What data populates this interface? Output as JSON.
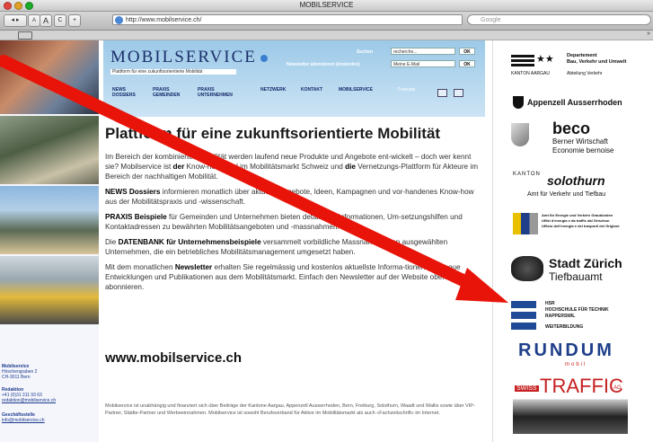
{
  "window": {
    "title": "MOBILSERVICE",
    "url": "http://www.mobilservice.ch/",
    "search_placeholder": "Google",
    "nav_back": "◂ ▸",
    "font_minus": "A",
    "font_plus": "A",
    "reload": "C",
    "add": "+"
  },
  "header": {
    "logo": "MOBILSERVICE",
    "tagline": "Plattform für eine zukunftsorientierte Mobilität",
    "search_label": "Suchen",
    "search_value": "recherche...",
    "newsletter_label": "Newsletter abonnieren (kostenlos)",
    "email_value": "Meine E-Mail",
    "ok": "OK",
    "nav": [
      {
        "label1": "NEWS",
        "label2": "DOSSIERS"
      },
      {
        "label1": "PRAXIS",
        "label2": "GEMEINDEN"
      },
      {
        "label1": "PRAXIS",
        "label2": "UNTERNEHMEN"
      },
      {
        "label1": "NETZWERK",
        "label2": ""
      },
      {
        "label1": "KONTAKT",
        "label2": ""
      },
      {
        "label1": "MOBILSERVICE",
        "label2": ""
      },
      {
        "label1": "Français",
        "label2": ""
      }
    ]
  },
  "main": {
    "title": "Plattform für eine zukunftsorientierte Mobilität",
    "p1_a": "Im Bereich der kombinierten Mobilität werden laufend neue Produkte und Angebote ent-wickelt – doch wer kennt sie? Mobilservice ist ",
    "p1_b": "der",
    "p1_c": " Know-how-Pool im Mobilitätsmarkt Schweiz und ",
    "p1_d": "die",
    "p1_e": " Vernetzungs-Plattform für Akteure im Bereich der nachhaltigen Mobilität.",
    "p2_b": "NEWS Dossiers",
    "p2_c": " informieren monatlich über aktuelle Angebote, Ideen, Kampagnen und vor-handenes Know-how aus der Mobilitätspraxis und -wissenschaft.",
    "p3_b": "PRAXIS Beispiele",
    "p3_c": " für Gemeinden und Unternehmen bieten detaillierte Informationen, Um-setzungshilfen und Kontaktadressen zu bewährten Mobilitätsangeboten und -massnahmen.",
    "p4_a": "Die ",
    "p4_b": "DATENBANK für Unternehmensbeispiele",
    "p4_c": " versammelt vorbildliche Massnahmen von ausgewählten Unternehmen, die ein betriebliches Mobilitätsmanagement umgesetzt haben.",
    "p5_a": "Mit dem monatlichen ",
    "p5_b": "Newsletter",
    "p5_c": " erhalten Sie regelmässig und kostenlos aktuellste Informa-tionen über neue Entwicklungen und Publikationen aus dem Mobilitätsmarkt. Einfach den Newsletter auf der Website oben rechts abonnieren.",
    "site_url": "www.mobilservice.ch",
    "footer": "Mobilservice ist unabhängig und finanziert sich über Beiträge der Kantone Aargau, Appenzell Ausserrhoden, Bern, Freiburg, Solothurn, Waadt und Wallis sowie über VIP-Partner, Städte-Partner und Werbeeinnahmen. Mobilservice ist sowohl Berufsverband für Aktive im Mobilitätsmarkt als auch «Fachzeitschrift» im Internet."
  },
  "sidebar": {
    "org": "Mobilservice",
    "street": "Hirschengraben 2",
    "city": "CH-3011 Bern",
    "redaktion_label": "Redaktion",
    "phone": "+41 (0)31 311 93 63",
    "redaktion_email": "redaktion@mobilservice.ch",
    "gs_label": "Geschäftsstelle",
    "gs_email": "info@mobilservice.ch"
  },
  "sponsors": {
    "aargau_1": "Departement",
    "aargau_2": "Bau, Verkehr und Umwelt",
    "aargau_3": "KANTON AARGAU",
    "aargau_4": "Abteilung Verkehr",
    "appenzell": "Appenzell Ausserrhoden",
    "beco": "beco",
    "beco_1": "Berner Wirtschaft",
    "beco_2": "Economie bernoise",
    "solo_1": "KANTON",
    "solo_2": "solothurn",
    "solo_3": "Amt für Verkehr und Tiefbau",
    "gr_1": "Amt für Energie und Verkehr Graubünden",
    "gr_2": "Uffizi d'energia e da traffic dal Grischun",
    "gr_3": "Ufficio dell'energia e dei trasporti dei Grigioni",
    "zh_1": "Stadt Zürich",
    "zh_2": "Tiefbauamt",
    "hsr_1": "HSR",
    "hsr_2": "HOCHSCHULE FÜR TECHNIK",
    "hsr_3": "RAPPERSWIL",
    "hsr_4": "WEITERBILDUNG",
    "rundum": "RUNDUM",
    "rundum_sub": "mobil",
    "traffic_1": "SWISS",
    "traffic_2": "TRAFFIC",
    "traffic_3": "AG"
  },
  "colors": {
    "arrow": "#e8140a",
    "accent": "#1b2f6a",
    "header": "#9cc9e8"
  }
}
